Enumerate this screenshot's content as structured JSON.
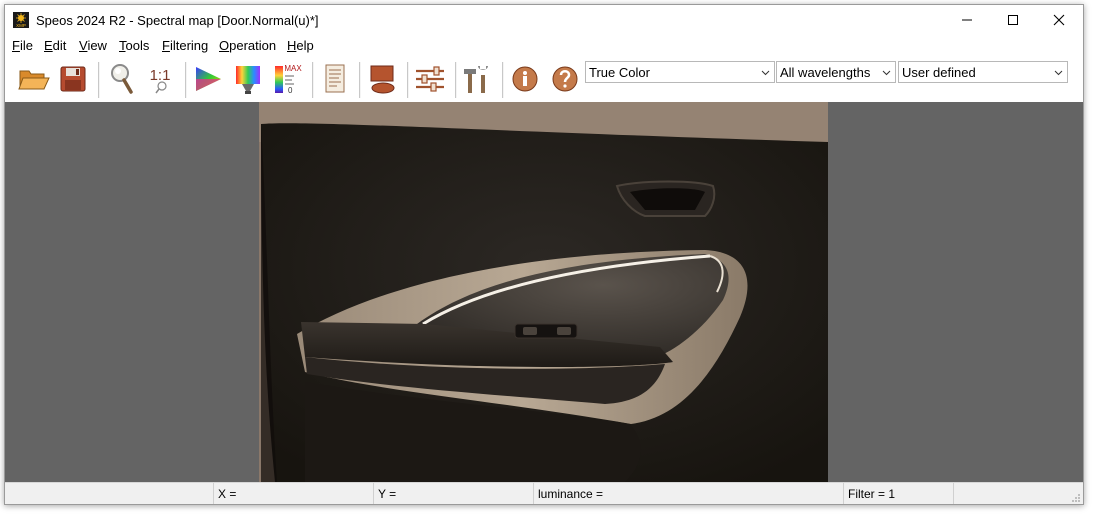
{
  "window": {
    "title": "Speos 2024 R2 - Spectral map [Door.Normal(u)*]",
    "app_icon_text": "XMP"
  },
  "menu": {
    "items": [
      {
        "mnemonic": "F",
        "rest": "ile"
      },
      {
        "mnemonic": "E",
        "rest": "dit"
      },
      {
        "mnemonic": "V",
        "rest": "iew"
      },
      {
        "mnemonic": "T",
        "rest": "ools"
      },
      {
        "mnemonic": "F",
        "rest": "iltering",
        "prefix": ""
      },
      {
        "mnemonic": "O",
        "rest": "peration"
      },
      {
        "mnemonic": "H",
        "rest": "elp"
      }
    ]
  },
  "toolbar": {
    "zoom_one_to_one": "1:1",
    "max_label": "MAX",
    "zero_label": "0",
    "color_mode": {
      "value": "True Color"
    },
    "wavelengths": {
      "value": "All wavelengths"
    },
    "scale_mode": {
      "value": "User defined"
    }
  },
  "statusbar": {
    "x_label": "X =",
    "y_label": "Y =",
    "luminance_label": "luminance =",
    "filter_label": "Filter = 1"
  },
  "icons": [
    "open-folder-icon",
    "save-icon",
    "zoom-icon",
    "actual-size-icon",
    "color-triangle-icon",
    "spectrum-icon",
    "max-scale-icon",
    "document-icon",
    "surface-icon",
    "settings-sliders-icon",
    "tools-icon",
    "info-icon",
    "help-icon"
  ]
}
